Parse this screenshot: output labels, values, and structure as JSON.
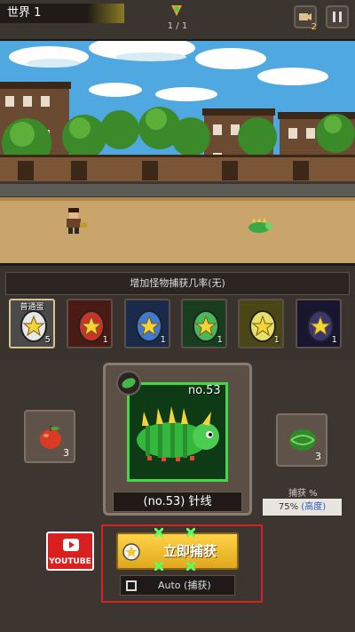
{
  "top": {
    "world_label": "世界 1",
    "stage_counter": "1 / 1",
    "camera_badge": "2"
  },
  "info": {
    "hint": "增加怪物捕获几率(无)"
  },
  "eggs": [
    {
      "label": "普通蛋",
      "count": "5",
      "color": "#e8e8e8",
      "bg": "#4a4a4a"
    },
    {
      "label": "",
      "count": "1",
      "color": "#c8342b",
      "bg": "#4a1a14"
    },
    {
      "label": "",
      "count": "1",
      "color": "#3f7bd2",
      "bg": "#1a2a4a"
    },
    {
      "label": "",
      "count": "1",
      "color": "#47b95a",
      "bg": "#193d1f"
    },
    {
      "label": "",
      "count": "1",
      "color": "#e6df6a",
      "bg": "#4a4615"
    },
    {
      "label": "",
      "count": "1",
      "color": "#3a3670",
      "bg": "#171530"
    }
  ],
  "items": {
    "left_count": "3",
    "right_count": "3"
  },
  "monster": {
    "number": "no.53",
    "name": "(no.53) 针线"
  },
  "capture": {
    "label": "捕获 %",
    "rate": "75%",
    "rate_level": "(高度)"
  },
  "youtube_label": "YOUTUBE",
  "buttons": {
    "capture_now": "立即捕获",
    "auto": "Auto (捕获)"
  },
  "colors": {
    "accent_gold": "#ffd347",
    "highlight_red": "#d42424",
    "monster_border": "#41d84a"
  }
}
